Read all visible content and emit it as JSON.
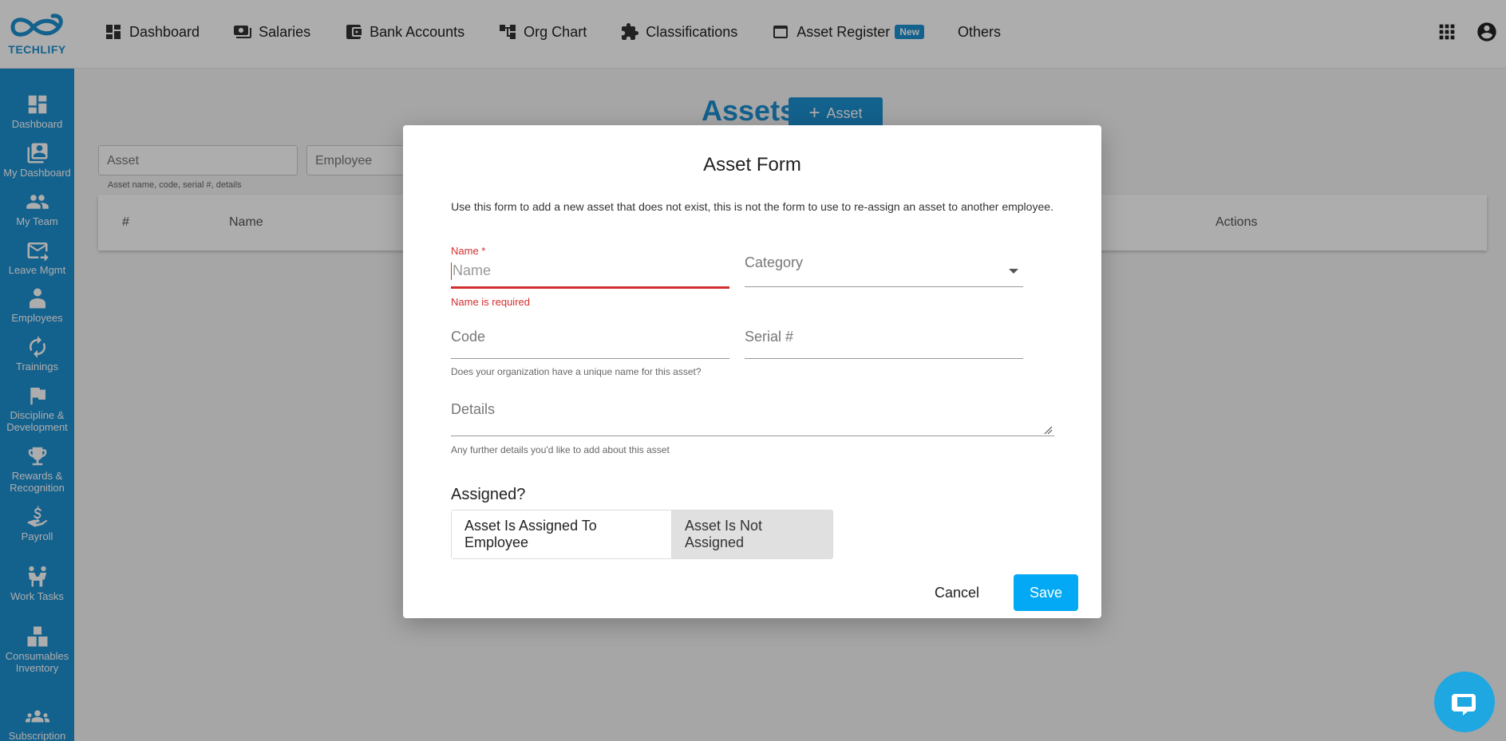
{
  "brand": {
    "name": "TECHLIFY",
    "color": "#1d8fd0"
  },
  "top_nav": {
    "items": [
      {
        "label": "Dashboard",
        "icon": "dashboard-icon"
      },
      {
        "label": "Salaries",
        "icon": "money-icon"
      },
      {
        "label": "Bank Accounts",
        "icon": "wallet-icon"
      },
      {
        "label": "Org Chart",
        "icon": "org-chart-icon"
      },
      {
        "label": "Classifications",
        "icon": "puzzle-icon"
      },
      {
        "label": "Asset Register",
        "icon": "window-icon",
        "badge": "New"
      },
      {
        "label": "Others",
        "icon": ""
      }
    ],
    "right_icons": [
      "apps-grid-icon",
      "account-circle-icon"
    ]
  },
  "sidebar": {
    "items": [
      {
        "label": "Dashboard",
        "icon": "dashboard-icon"
      },
      {
        "label": "My Dashboard",
        "icon": "profile-card-icon"
      },
      {
        "label": "My Team",
        "icon": "team-icon"
      },
      {
        "label": "Leave Mgmt",
        "icon": "mail-icon"
      },
      {
        "label": "Employees",
        "icon": "employee-icon"
      },
      {
        "label": "Trainings",
        "icon": "trainings-icon"
      },
      {
        "label": "Discipline & Development",
        "icon": "flag-icon"
      },
      {
        "label": "Rewards & Recognition",
        "icon": "trophy-icon"
      },
      {
        "label": "Payroll",
        "icon": "payroll-icon"
      },
      {
        "label": "Work Tasks",
        "icon": "work-tasks-icon"
      },
      {
        "label": "Consumables Inventory",
        "icon": "inventory-icon"
      },
      {
        "label": "Subscription",
        "icon": "group-icon"
      }
    ]
  },
  "page": {
    "title": "Assets",
    "add_button": "Asset",
    "filters": {
      "asset_placeholder": "Asset",
      "employee_placeholder": "Employee",
      "asset_hint": "Asset name, code, serial #, details"
    },
    "table_headers": {
      "num": "#",
      "name": "Name",
      "actions": "Actions"
    }
  },
  "modal": {
    "title": "Asset Form",
    "description": "Use this form to add a new asset that does not exist, this is not the form to use to re-assign an asset to another employee.",
    "name": {
      "label": "Name *",
      "placeholder": "Name",
      "error": "Name is required"
    },
    "category": {
      "placeholder": "Category"
    },
    "code": {
      "placeholder": "Code",
      "help": "Does your organization have a unique name for this asset?"
    },
    "serial": {
      "placeholder": "Serial #"
    },
    "details": {
      "placeholder": "Details",
      "help": "Any further details you'd like to add about this asset"
    },
    "assigned": {
      "label": "Assigned?",
      "options": [
        "Asset Is Assigned To Employee",
        "Asset Is Not Assigned"
      ],
      "selected": "Asset Is Not Assigned"
    },
    "cancel": "Cancel",
    "save": "Save"
  },
  "colors": {
    "accent": "#1d8fd0",
    "save": "#03a9f4",
    "error": "#d32f2f",
    "chat": "#1ea7e1"
  }
}
